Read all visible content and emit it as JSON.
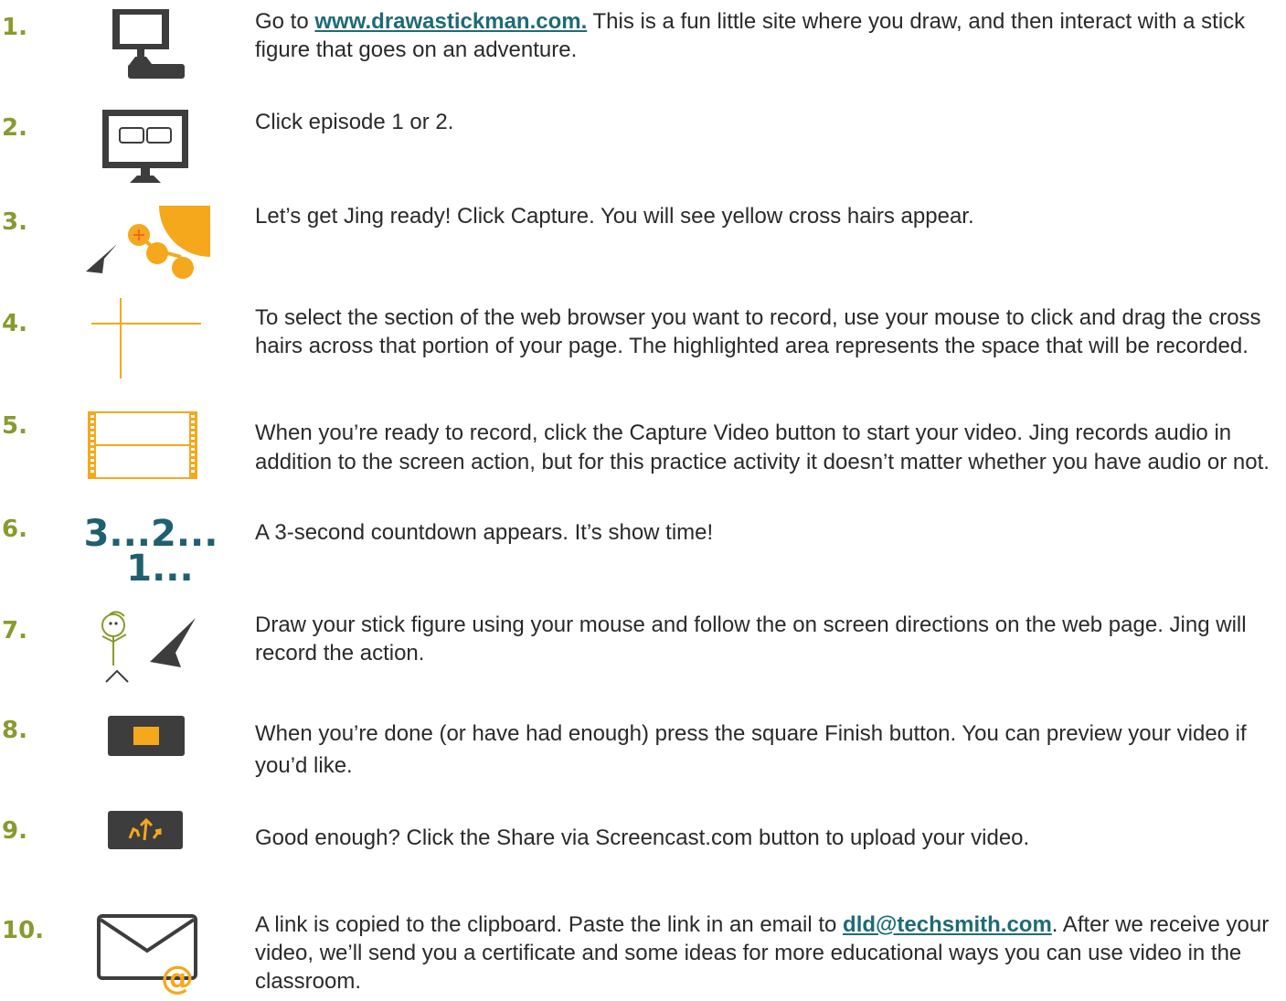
{
  "steps": [
    {
      "number": "1.",
      "icon": "computer-keyboard-icon",
      "text_before": "Go to ",
      "link": "www.drawastickman.com.",
      "text_after": " This is a fun little site where you draw, and then interact with a stick figure that goes on an adventure."
    },
    {
      "number": "2.",
      "icon": "monitor-episodes-icon",
      "text": "Click episode 1 or 2."
    },
    {
      "number": "3.",
      "icon": "jing-sun-cursor-icon",
      "text": "Let’s get Jing ready! Click Capture. You will see yellow cross hairs appear."
    },
    {
      "number": "4.",
      "icon": "crosshair-icon",
      "text": "To select the section of the web browser you want to record, use your mouse to click and drag the cross hairs across that portion of your page. The highlighted area represents the space that will be recorded."
    },
    {
      "number": "5.",
      "icon": "film-strip-icon",
      "text": "When you’re ready to record, click the Capture Video button to start your video. Jing records audio in addition to the screen action, but for this practice activity it doesn’t matter whether you have audio or not."
    },
    {
      "number": "6.",
      "icon": "countdown-icon",
      "countdown_line1": "3...2...",
      "countdown_line2": "1...",
      "text": "A 3-second countdown appears. It’s show time!"
    },
    {
      "number": "7.",
      "icon": "stick-figure-cursor-icon",
      "text": "Draw your stick figure using your mouse and follow the on screen directions on the web page. Jing will record the action."
    },
    {
      "number": "8.",
      "icon": "finish-button-icon",
      "text": "When you’re done (or have had enough) press the square Finish button. You can preview your video if you’d like."
    },
    {
      "number": "9.",
      "icon": "share-button-icon",
      "text": "Good enough? Click the Share via Screencast.com button to upload your video."
    },
    {
      "number": "10.",
      "icon": "email-at-icon",
      "text_before": "A link is copied to the clipboard. Paste the link in an email to ",
      "link": "dld@techsmith.com",
      "text_after": ". After we receive your video, we’ll send you a certificate and some ideas for more educational ways you can use video in the classroom."
    }
  ],
  "colors": {
    "number": "#8a9a2e",
    "accent": "#f5a81c",
    "dark": "#3d3d3d",
    "link": "#1f6b76"
  }
}
